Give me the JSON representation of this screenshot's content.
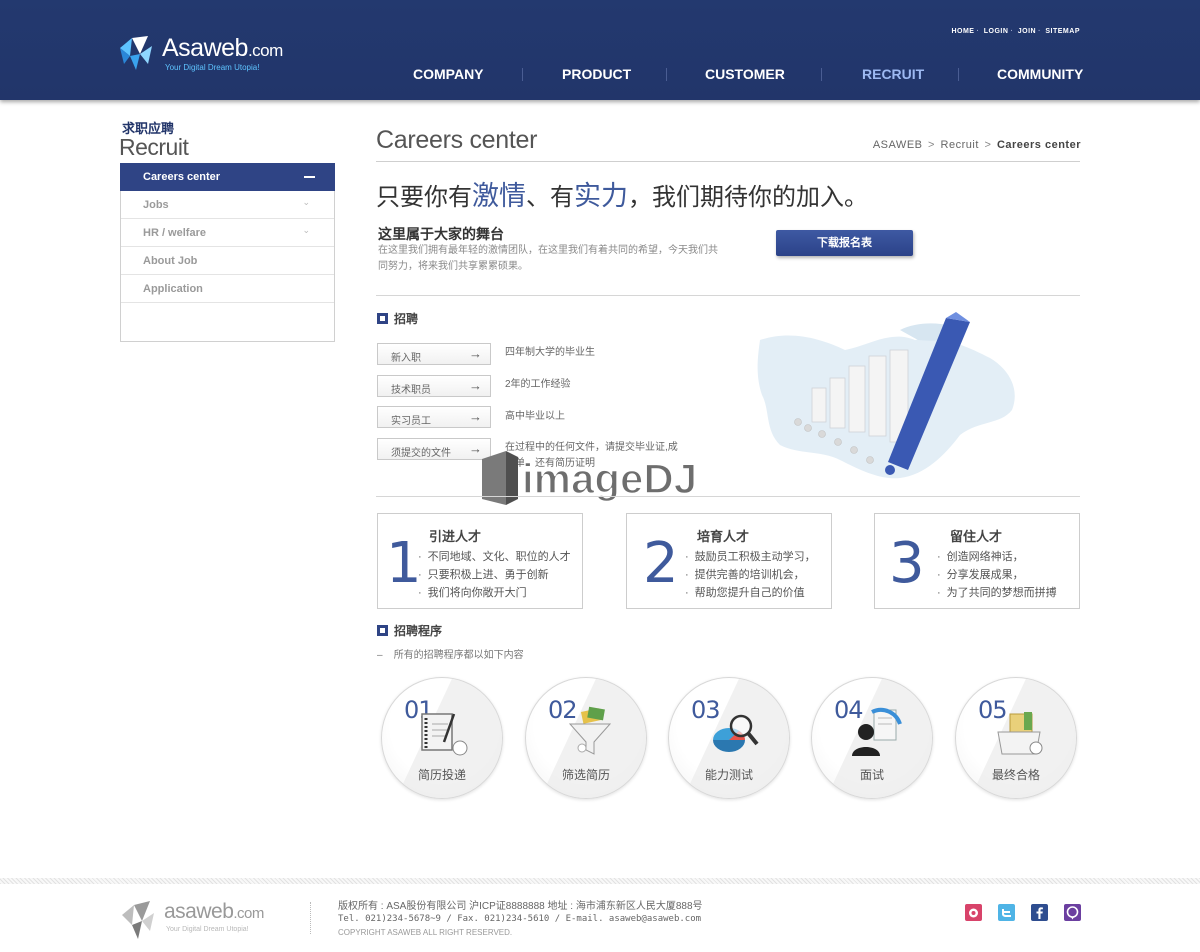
{
  "header": {
    "logo_name": "Asaweb",
    "logo_suffix": ".com",
    "logo_tagline": "Your Digital Dream Utopia!",
    "util_links": [
      "HOME",
      "LOGIN",
      "JOIN",
      "SITEMAP"
    ],
    "nav": [
      "COMPANY",
      "PRODUCT",
      "CUSTOMER",
      "RECRUIT",
      "COMMUNITY"
    ],
    "nav_active": "RECRUIT"
  },
  "sidebar": {
    "title_ko": "求职应聘",
    "title_en": "Recruit",
    "items": [
      {
        "label": "Careers center",
        "active": true
      },
      {
        "label": "Jobs",
        "active": false
      },
      {
        "label": "HR / welfare",
        "active": false
      },
      {
        "label": "About Job",
        "active": false
      },
      {
        "label": "Application",
        "active": false
      }
    ]
  },
  "main": {
    "title": "Careers center",
    "breadcrumb": [
      "ASAWEB",
      "Recruit",
      "Careers center"
    ],
    "slogan": {
      "p1": "只要你有",
      "h1": "激情",
      "p2": "、有",
      "h2": "实力",
      "p3": "，我们期待你的加入。"
    },
    "stage_title": "这里属于大家的舞台",
    "stage_desc": "在这里我们拥有最年轻的激情团队，在这里我们有着共同的希望，今天我们共同努力，将来我们共享累累硕果。",
    "download_label": "下载报名表",
    "recruit_heading": "招聘",
    "jobs": [
      {
        "label": "新入职",
        "desc": "四年制大学的毕业生"
      },
      {
        "label": "技术职员",
        "desc": "2年的工作经验"
      },
      {
        "label": "实习员工",
        "desc": "高中毕业以上"
      },
      {
        "label": "须提交的文件",
        "desc": "在过程中的任何文件，请提交毕业证,成绩单，还有简历证明"
      }
    ],
    "watermark": "imageDJ",
    "cards": [
      {
        "num": "1",
        "title": "引进人才",
        "items": [
          "不同地域、文化、职位的人才",
          "只要积极上进、勇于创新",
          "我们将向你敞开大门"
        ]
      },
      {
        "num": "2",
        "title": "培育人才",
        "items": [
          "鼓励员工积极主动学习，",
          "提供完善的培训机会，",
          "帮助您提升自己的价值"
        ]
      },
      {
        "num": "3",
        "title": "留住人才",
        "items": [
          "创造网络神话，",
          "分享发展成果，",
          "为了共同的梦想而拼搏"
        ]
      }
    ],
    "process_heading": "招聘程序",
    "process_sub": "所有的招聘程序都以如下内容",
    "process_dash": "–",
    "steps": [
      {
        "num": "01",
        "label": "简历投递"
      },
      {
        "num": "02",
        "label": "筛选简历"
      },
      {
        "num": "03",
        "label": "能力测试"
      },
      {
        "num": "04",
        "label": "面试"
      },
      {
        "num": "05",
        "label": "最终合格"
      }
    ]
  },
  "footer": {
    "logo_name": "asaweb",
    "logo_suffix": ".com",
    "logo_tagline": "Your Digital Dream Utopia!",
    "line1": "版权所有 : ASA股份有限公司 沪ICP证8888888    地址 : 海市浦东新区人民大厦888号",
    "line2": "Tel. 021)234-5678~9  / Fax. 021)234-5610  / E-mail. asaweb@asaweb.com",
    "line3": "COPYRIGHT ASAWEB ALL RIGHT RESERVED.",
    "sns": [
      {
        "name": "blog-icon",
        "color": "#d8436a"
      },
      {
        "name": "twitter-icon",
        "color": "#4fb4e6"
      },
      {
        "name": "facebook-icon",
        "color": "#2e4d8f"
      },
      {
        "name": "chat-icon",
        "color": "#6b3fa0"
      }
    ]
  },
  "colors": {
    "header_bg": "#22356a",
    "accent": "#3f5a9c",
    "nav_active": "#9db9f2"
  }
}
